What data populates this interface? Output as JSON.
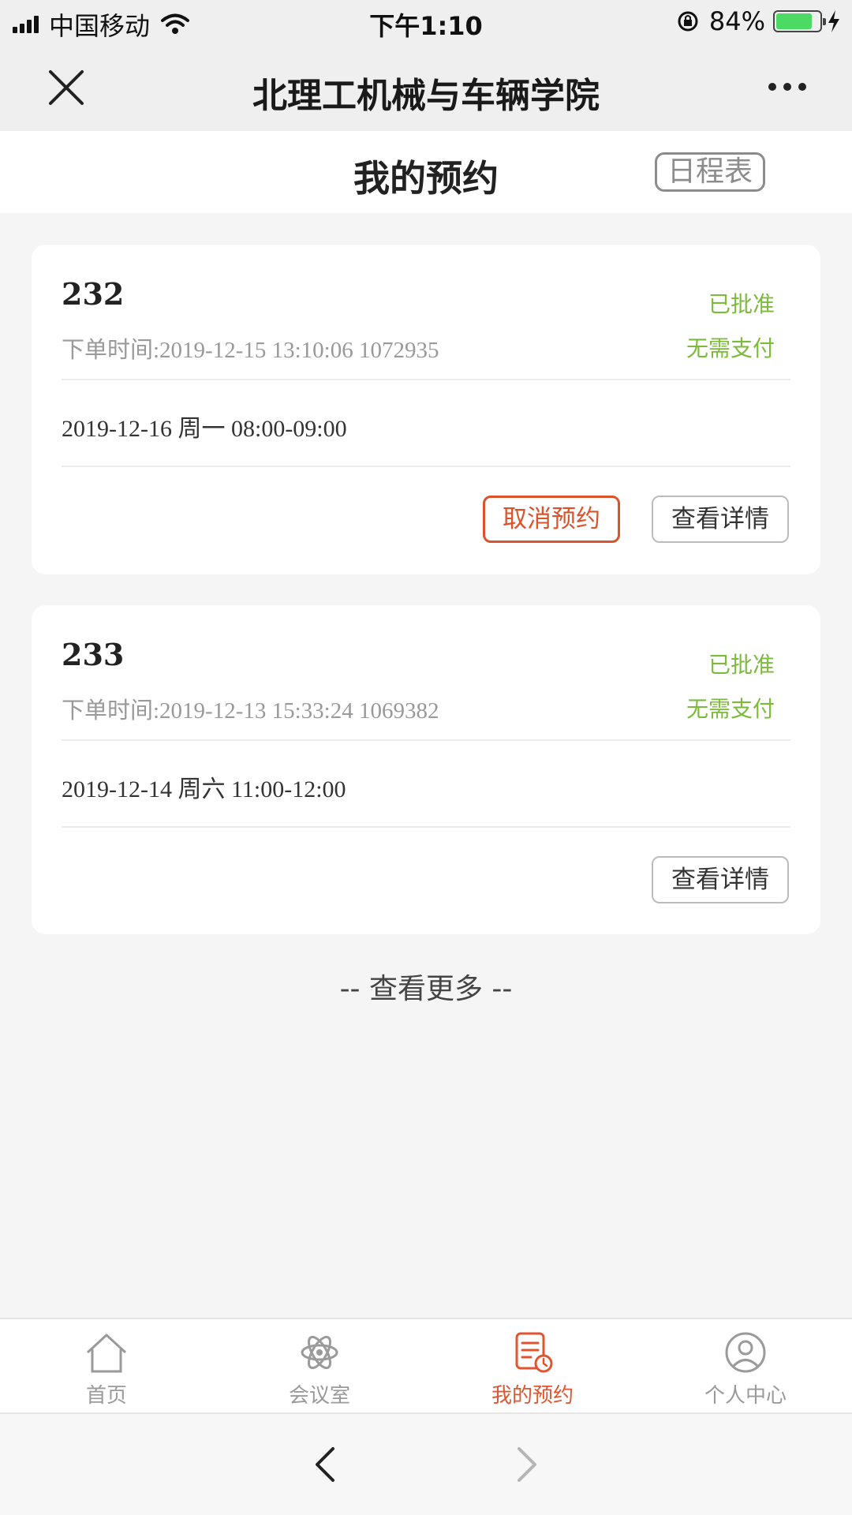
{
  "status_bar": {
    "carrier": "中国移动",
    "time": "下午1:10",
    "battery": "84%",
    "battery_level": 0.84
  },
  "nav": {
    "title": "北理工机械与车辆学院"
  },
  "header": {
    "title": "我的预约",
    "schedule_label": "日程表"
  },
  "bookings": [
    {
      "id": "232",
      "order_time": "下单时间:2019-12-15 13:10:06 1072935",
      "status": "已批准",
      "payment": "无需支付",
      "slot": "2019-12-16 周一 08:00-09:00",
      "cancel_label": "取消预约",
      "detail_label": "查看详情"
    },
    {
      "id": "233",
      "order_time": "下单时间:2019-12-13 15:33:24 1069382",
      "status": "已批准",
      "payment": "无需支付",
      "slot": "2019-12-14 周六 11:00-12:00",
      "detail_label": "查看详情"
    }
  ],
  "more_label": "-- 查看更多 --",
  "tabs": [
    {
      "label": "首页",
      "icon": "home-icon"
    },
    {
      "label": "会议室",
      "icon": "atom-icon"
    },
    {
      "label": "我的预约",
      "icon": "booking-list-icon"
    },
    {
      "label": "个人中心",
      "icon": "user-circle-icon"
    }
  ],
  "colors": {
    "accent": "#e0552f",
    "approved": "#7cba3c"
  }
}
